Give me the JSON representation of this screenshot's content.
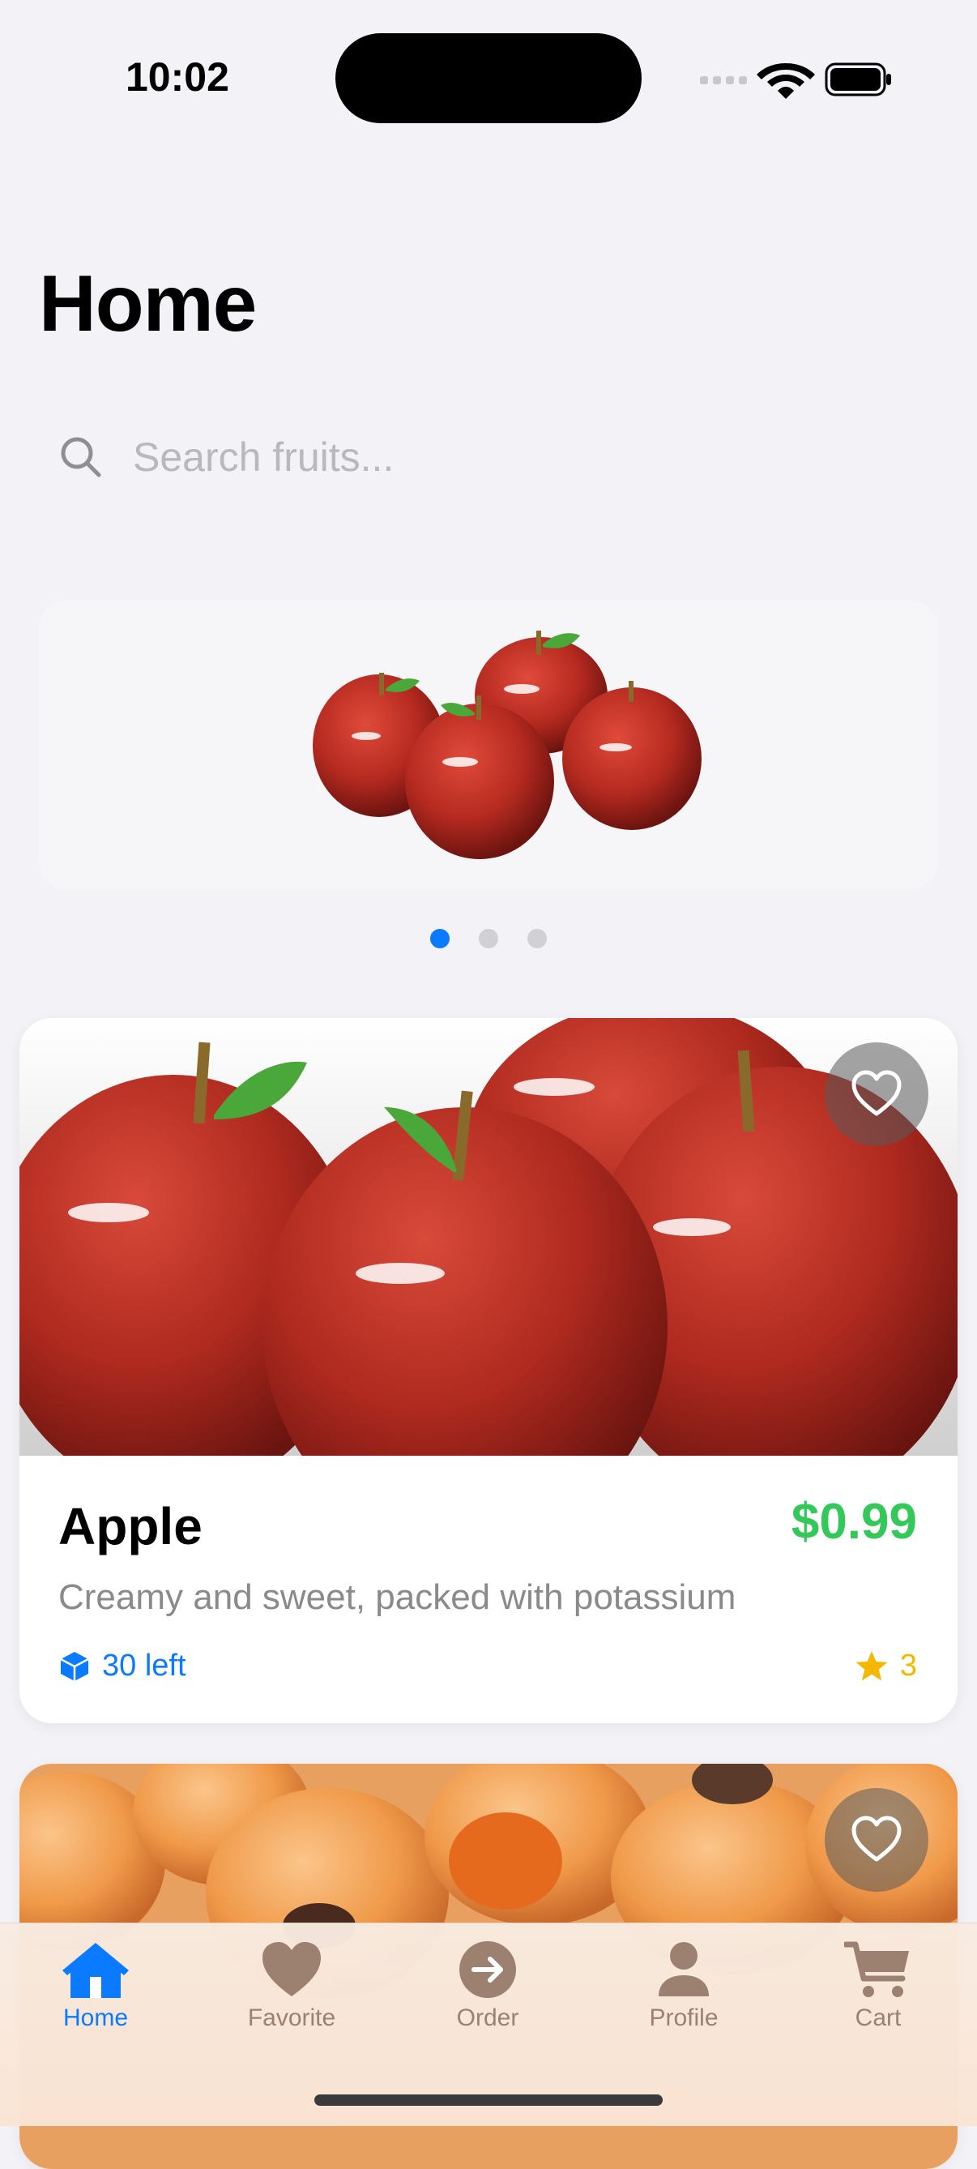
{
  "status_bar": {
    "time": "10:02"
  },
  "header": {
    "title": "Home"
  },
  "search": {
    "placeholder": "Search fruits..."
  },
  "banner": {
    "slides": 3,
    "active_slide": 1
  },
  "products": [
    {
      "name": "Apple",
      "price": "$0.99",
      "description": "Creamy and sweet, packed with potassium",
      "stock": "30 left",
      "rating": "3"
    }
  ],
  "tab_bar": {
    "items": [
      {
        "label": "Home",
        "icon": "house-icon",
        "active": true
      },
      {
        "label": "Favorite",
        "icon": "heart-icon",
        "active": false
      },
      {
        "label": "Order",
        "icon": "arrow-circle-icon",
        "active": false
      },
      {
        "label": "Profile",
        "icon": "person-icon",
        "active": false
      },
      {
        "label": "Cart",
        "icon": "cart-icon",
        "active": false
      }
    ]
  },
  "colors": {
    "accent": "#0a7aff",
    "price": "#34c759",
    "star": "#f5b800",
    "inactive_tab": "#9c8170"
  }
}
